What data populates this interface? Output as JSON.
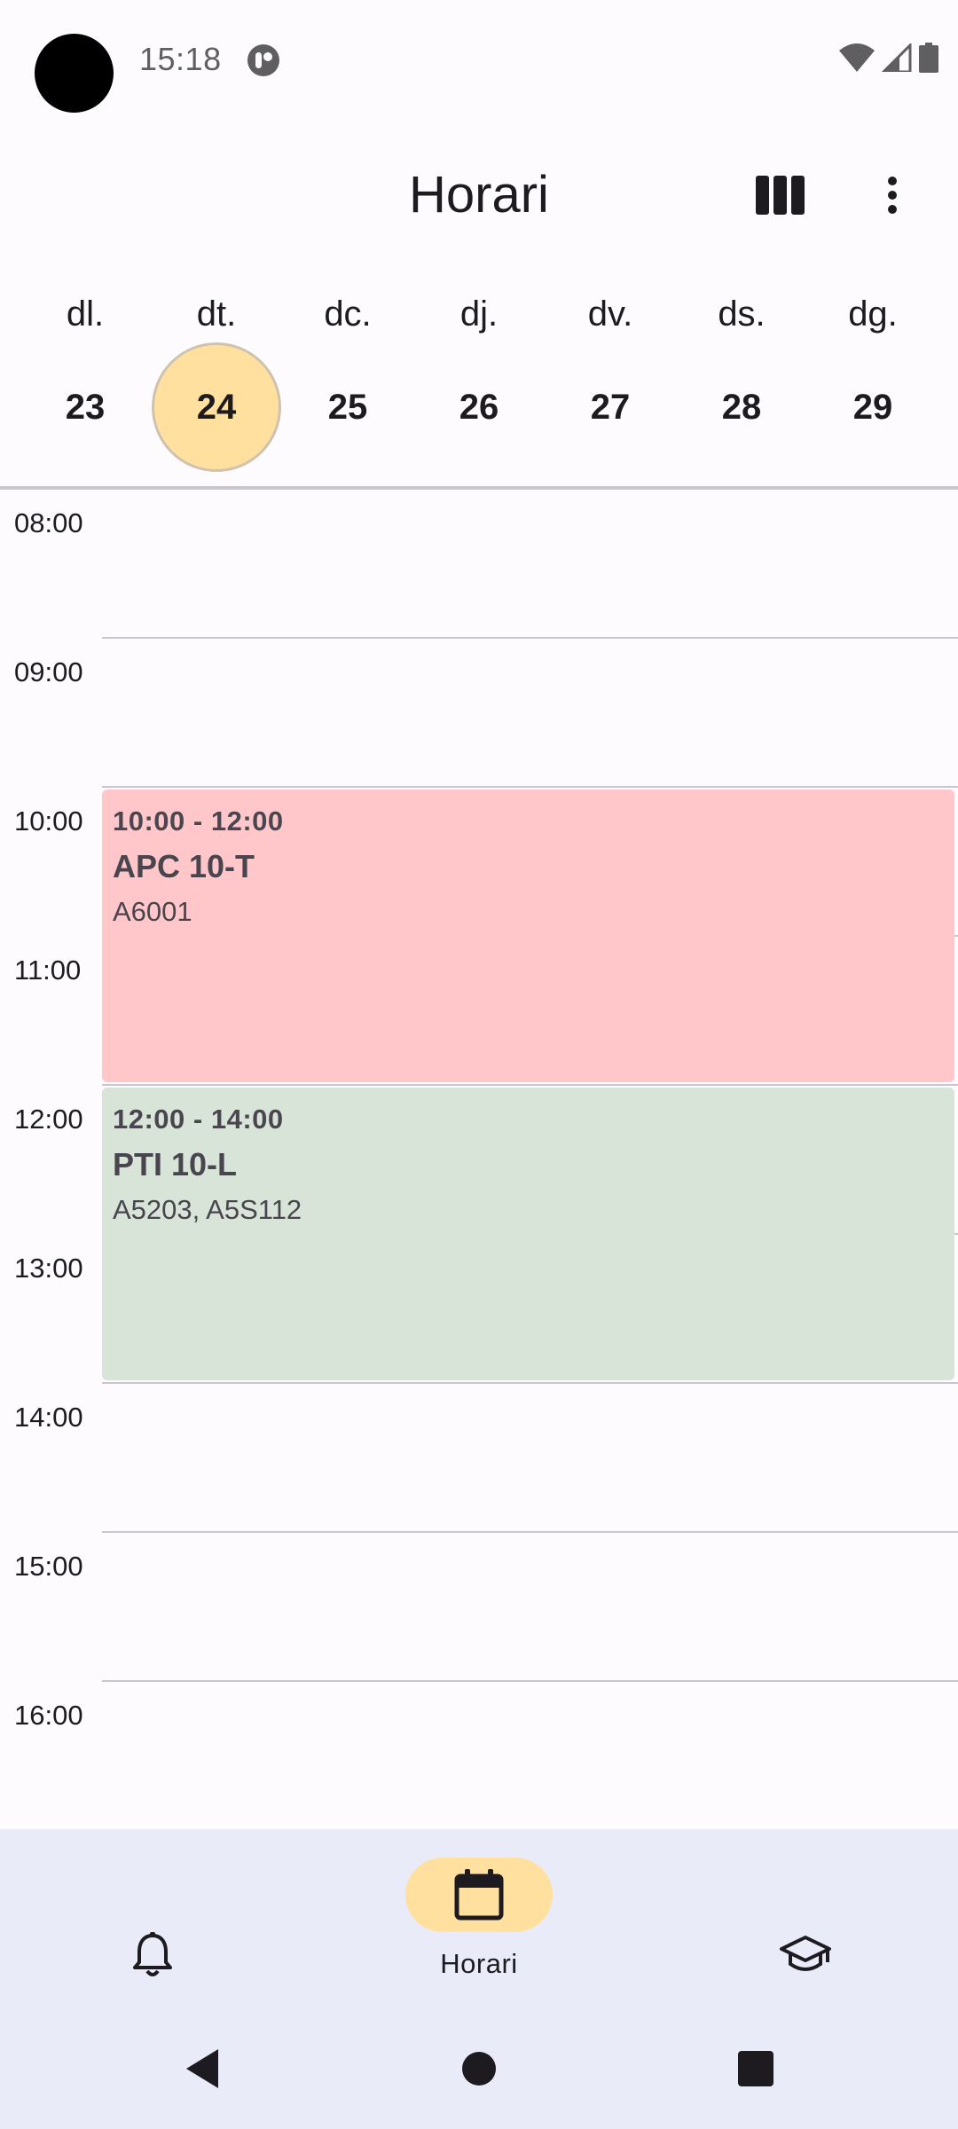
{
  "status_bar": {
    "time": "15:18"
  },
  "app_bar": {
    "title": "Horari",
    "view_icon": "column-view-icon",
    "more_icon": "more-vert-icon"
  },
  "week": {
    "days": [
      {
        "name": "dl.",
        "num": "23"
      },
      {
        "name": "dt.",
        "num": "24",
        "selected": true
      },
      {
        "name": "dc.",
        "num": "25"
      },
      {
        "name": "dj.",
        "num": "26"
      },
      {
        "name": "dv.",
        "num": "27"
      },
      {
        "name": "ds.",
        "num": "28"
      },
      {
        "name": "dg.",
        "num": "29"
      }
    ]
  },
  "timeline": {
    "hours": [
      "08:00",
      "09:00",
      "10:00",
      "11:00",
      "12:00",
      "13:00",
      "14:00",
      "15:00",
      "16:00"
    ],
    "events": [
      {
        "time": "10:00 - 12:00",
        "title": "APC 10-T",
        "room": "A6001",
        "color": "#ffc7c9"
      },
      {
        "time": "12:00 - 14:00",
        "title": "PTI 10-L",
        "room": "A5203, A5S112",
        "color": "#d9e4d9"
      }
    ]
  },
  "bottom_nav": {
    "items": [
      {
        "icon": "bell-icon",
        "label": ""
      },
      {
        "icon": "calendar-icon",
        "label": "Horari",
        "active": true
      },
      {
        "icon": "graduation-cap-icon",
        "label": ""
      }
    ]
  },
  "colors": {
    "accent": "#ffe09e",
    "background": "#fdfbfe",
    "nav_background": "#e9ecf8"
  }
}
